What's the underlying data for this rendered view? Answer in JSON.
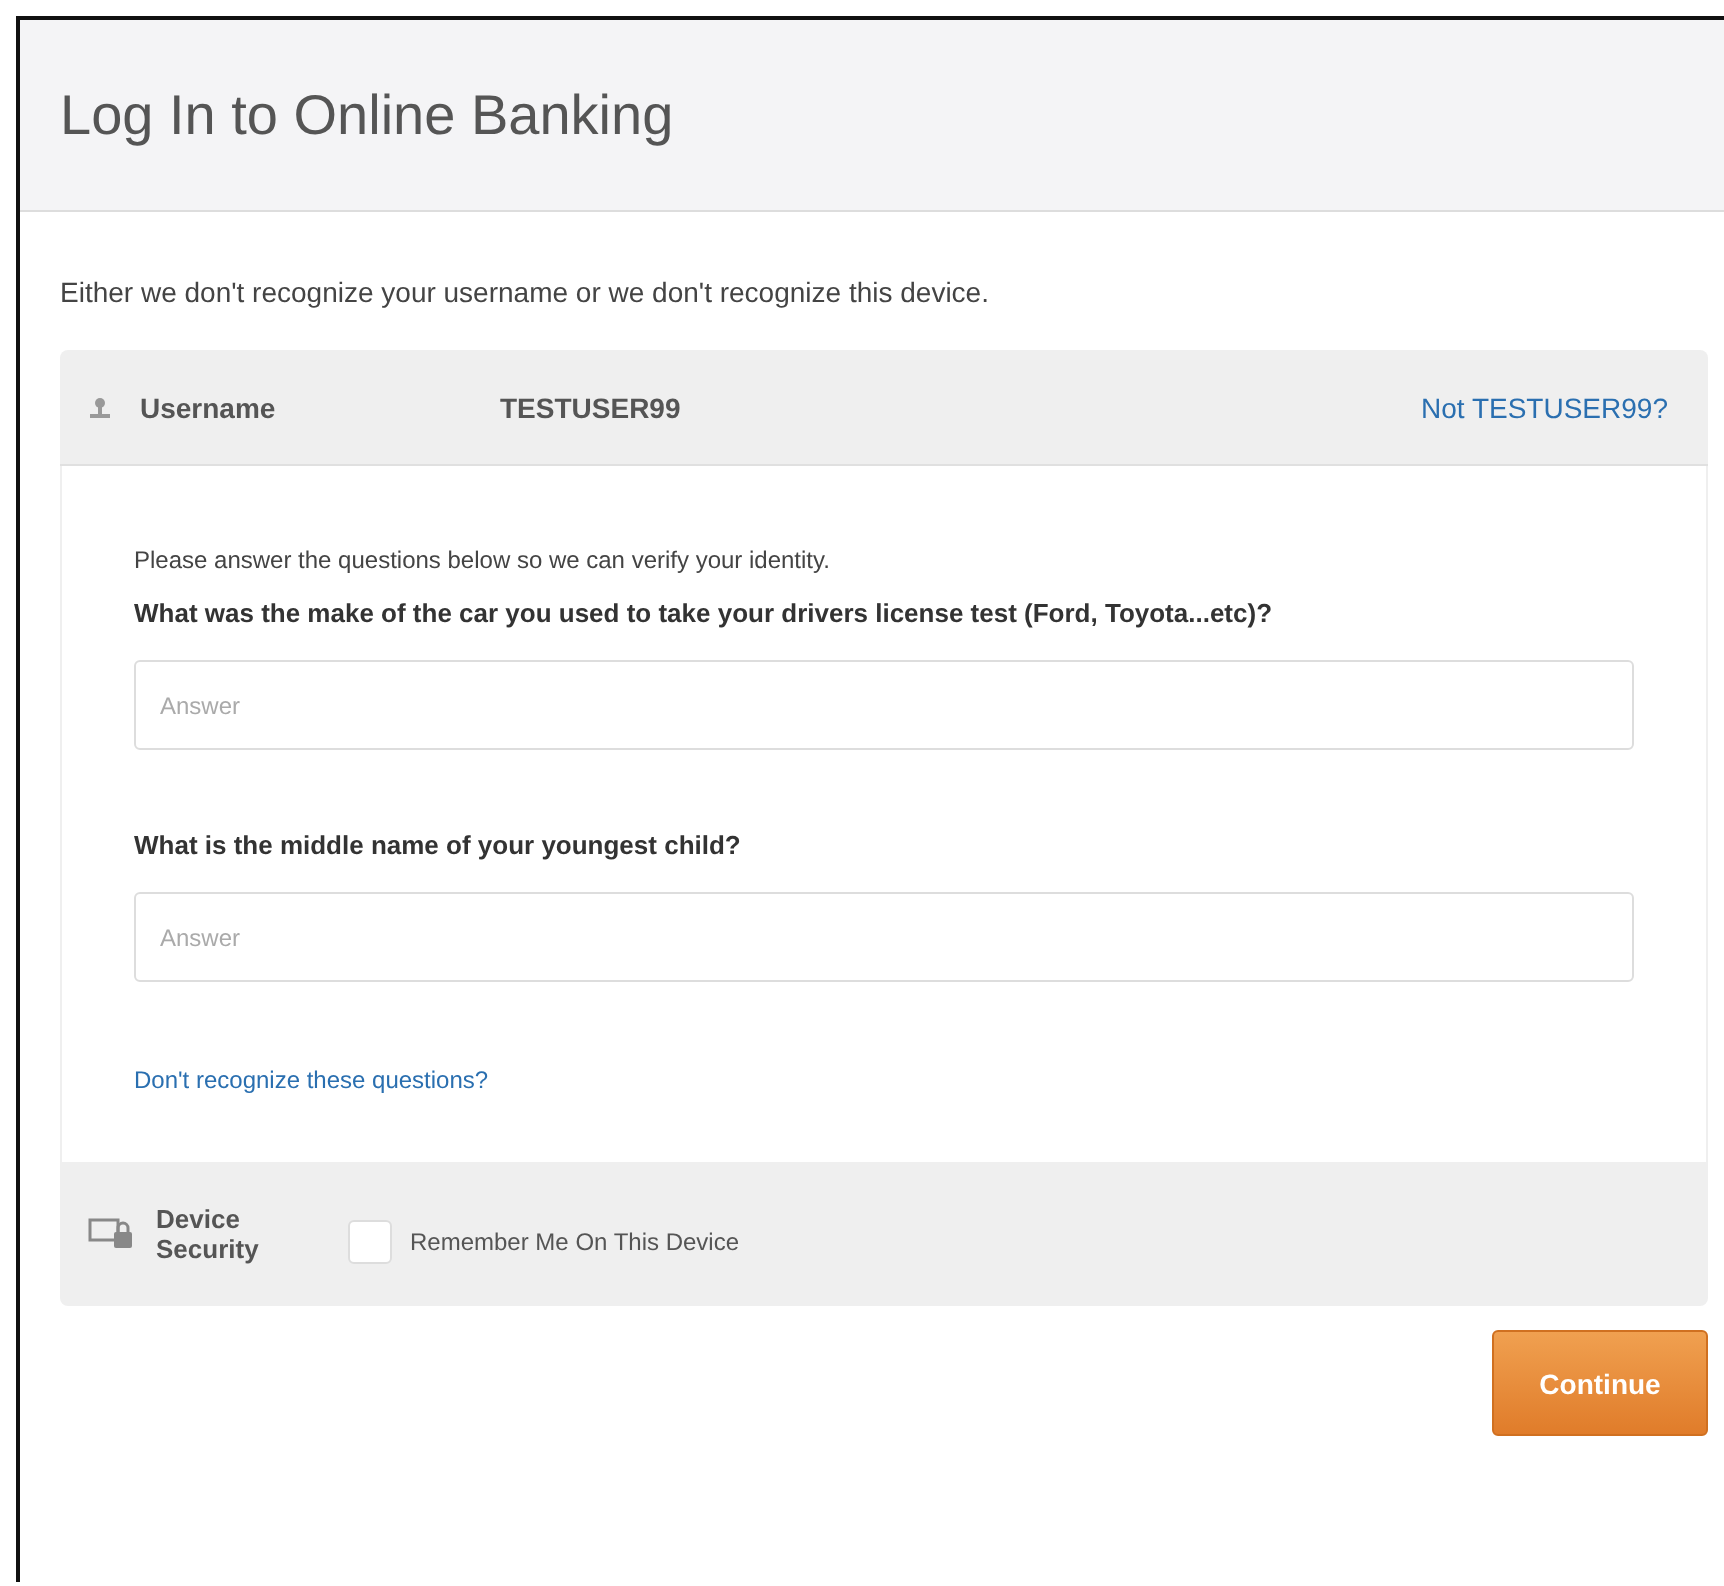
{
  "header": {
    "title": "Log In to Online Banking"
  },
  "intro": "Either we don't recognize your username or we don't recognize this device.",
  "username": {
    "label": "Username",
    "value": "TESTUSER99",
    "link": "Not TESTUSER99?"
  },
  "instructions": "Please answer the questions below so we can verify your identity.",
  "questions": [
    {
      "question": "What was the make of the car you used to take your drivers license test (Ford, Toyota...etc)?",
      "placeholder": "Answer"
    },
    {
      "question": "What is the middle name of your youngest child?",
      "placeholder": "Answer"
    }
  ],
  "help_link": "Don't recognize these questions?",
  "device": {
    "label": "Device Security",
    "remember_label": "Remember Me On This Device",
    "checked": false
  },
  "buttons": [
    "Continue"
  ]
}
